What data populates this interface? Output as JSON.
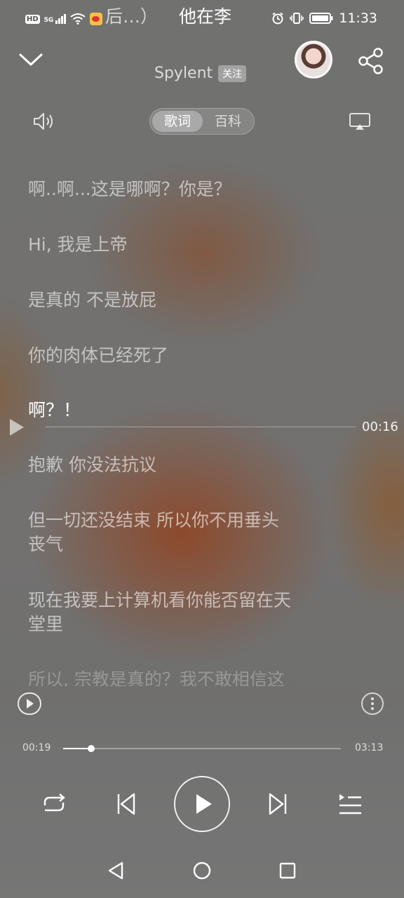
{
  "status_bar": {
    "hd": "HD",
    "network": "5G",
    "time": "11:33"
  },
  "header": {
    "title_part1": "后…）",
    "title_part2": "他在李",
    "artist": "Spylent",
    "follow_label": "关注"
  },
  "tabs": [
    {
      "label": "歌词",
      "active": true
    },
    {
      "label": "百科",
      "active": false
    }
  ],
  "lyrics": [
    {
      "text": "啊..啊...这是哪啊？你是？",
      "state": "normal"
    },
    {
      "text": "Hi, 我是上帝",
      "state": "normal"
    },
    {
      "text": "是真的 不是放屁",
      "state": "normal"
    },
    {
      "text": "你的肉体已经死了",
      "state": "normal"
    },
    {
      "text": "啊？！",
      "state": "current"
    },
    {
      "text": "抱歉 你没法抗议",
      "state": "normal"
    },
    {
      "text": "但一切还没结束 所以你不用垂头\n丧气",
      "state": "normal"
    },
    {
      "text": "现在我要上计算机看你能否留在天\n堂里",
      "state": "normal"
    },
    {
      "text": "所以, 宗教是真的？我不敢相信这",
      "state": "fade"
    }
  ],
  "seek_marker_time": "00:16",
  "progress": {
    "current": "00:19",
    "total": "03:13",
    "fraction": 0.1
  },
  "icons": {
    "back": "chevron-down-icon",
    "share": "share-icon",
    "volume": "speaker-icon",
    "cast": "cast-icon"
  }
}
